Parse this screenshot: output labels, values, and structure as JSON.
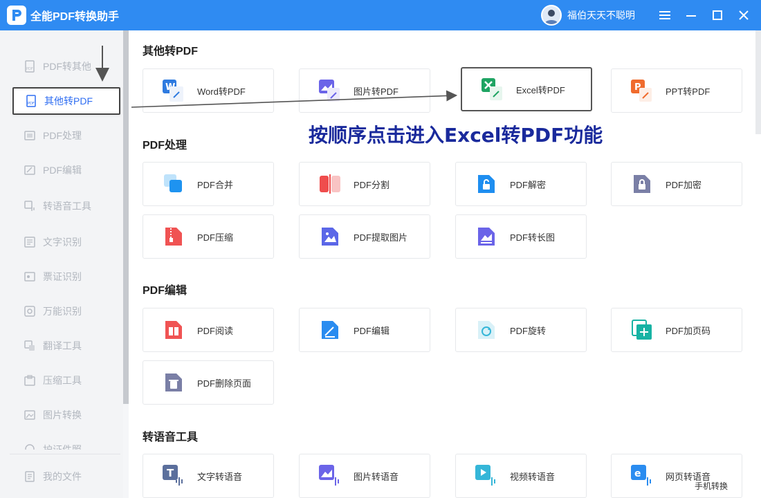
{
  "app": {
    "title": "全能PDF转换助手",
    "username": "福伯天天不聪明",
    "logo": "P"
  },
  "window_controls": [
    "menu-icon",
    "minimize-icon",
    "maximize-icon",
    "close-icon"
  ],
  "sidebar": {
    "items": [
      {
        "label": "PDF转其他",
        "icon": "pdf-export-icon"
      },
      {
        "label": "其他转PDF",
        "icon": "pdf-import-icon",
        "active": true
      },
      {
        "label": "PDF处理",
        "icon": "pdf-process-icon"
      },
      {
        "label": "PDF编辑",
        "icon": "pdf-edit-icon"
      },
      {
        "label": "转语音工具",
        "icon": "voice-icon"
      },
      {
        "label": "文字识别",
        "icon": "ocr-icon"
      },
      {
        "label": "票证识别",
        "icon": "ticket-icon"
      },
      {
        "label": "万能识别",
        "icon": "universal-icon"
      },
      {
        "label": "翻译工具",
        "icon": "translate-icon"
      },
      {
        "label": "压缩工具",
        "icon": "compress-icon"
      },
      {
        "label": "图片转换",
        "icon": "image-convert-icon"
      },
      {
        "label": "护证件照",
        "icon": "id-photo-icon"
      }
    ],
    "my_files": "我的文件"
  },
  "sections": [
    {
      "title": "其他转PDF",
      "cards": [
        "Word转PDF",
        "图片转PDF",
        "Excel转PDF",
        "PPT转PDF"
      ]
    },
    {
      "title": "PDF处理",
      "cards": [
        "PDF合并",
        "PDF分割",
        "PDF解密",
        "PDF加密",
        "PDF压缩",
        "PDF提取图片",
        "PDF转长图"
      ]
    },
    {
      "title": "PDF编辑",
      "cards": [
        "PDF阅读",
        "PDF编辑",
        "PDF旋转",
        "PDF加页码",
        "PDF删除页面"
      ]
    },
    {
      "title": "转语音工具",
      "cards": [
        "文字转语音",
        "图片转语音",
        "视频转语音",
        "网页转语音"
      ]
    }
  ],
  "annotation": "按顺序点击进入Excel转PDF功能",
  "watermark": "手机转换",
  "colors": {
    "accent": "#2f8bf2",
    "annotation": "#1a2a9c",
    "active_text": "#2f6ef2"
  }
}
